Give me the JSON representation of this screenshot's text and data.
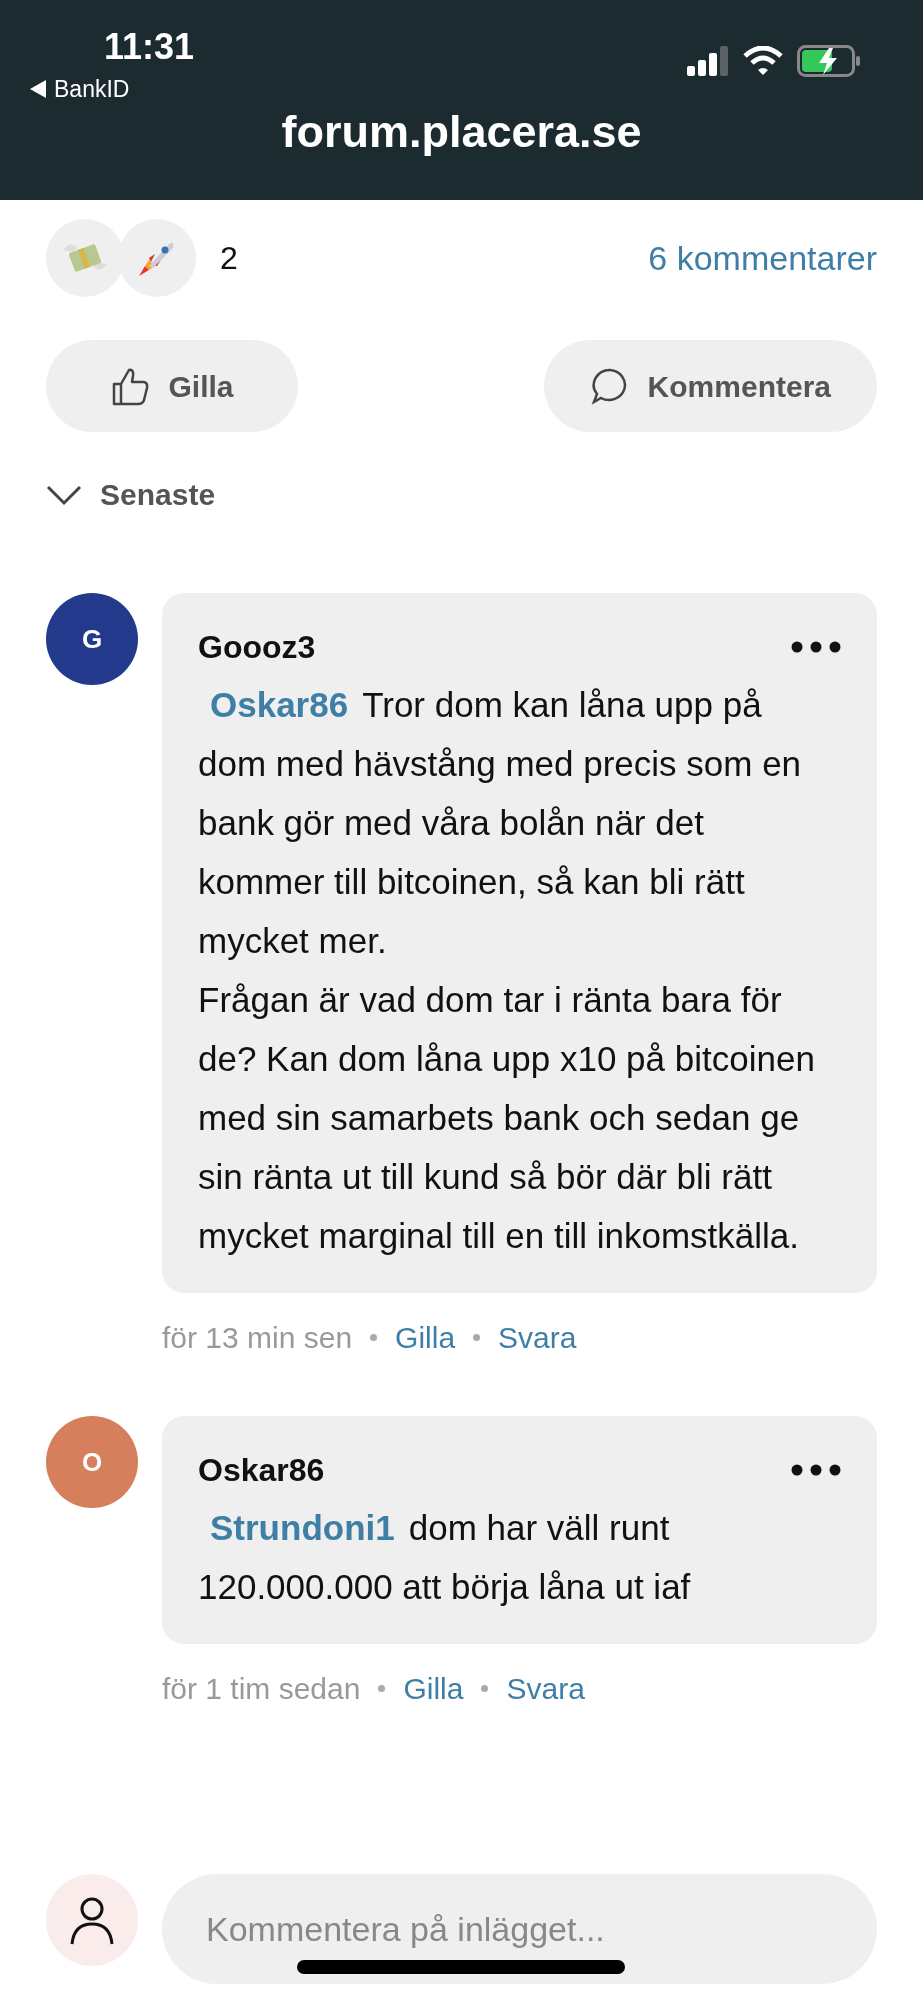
{
  "status_bar": {
    "time": "11:31",
    "back_label": "BankID",
    "url": "forum.placera.se"
  },
  "reactions": {
    "count": "2",
    "comments_link": "6 kommentarer"
  },
  "actions": [
    {
      "kind": "like",
      "label": "Gilla"
    },
    {
      "kind": "comment",
      "label": "Kommentera"
    }
  ],
  "sort": {
    "label": "Senaste",
    "expanded": true
  },
  "comments": [
    {
      "avatar": "G",
      "color": "#233a8c",
      "author": "Goooz3",
      "mention": "Oskar86",
      "text": "Tror dom kan låna upp på dom med hävstång med precis som en bank gör med våra bolån när det kommer till bitcoinen, så kan bli rätt mycket mer.\nFrågan är vad dom tar i ränta bara för de? Kan dom låna upp x10 på bitcoinen med sin samarbets bank och sedan ge sin ränta ut till kund så bör där bli rätt mycket marginal till en till inkomstkälla.",
      "time": "för 13 min sen",
      "like": "Gilla",
      "reply": "Svara"
    },
    {
      "avatar": "O",
      "color": "#d57f5c",
      "author": "Oskar86",
      "mention": "Strundoni1",
      "text": "dom har väll runt 120.000.000 att börja låna ut iaf",
      "time": "för 1 tim sedan",
      "like": "Gilla",
      "reply": "Svara"
    }
  ],
  "composer": {
    "placeholder": "Kommentera på inlägget..."
  }
}
